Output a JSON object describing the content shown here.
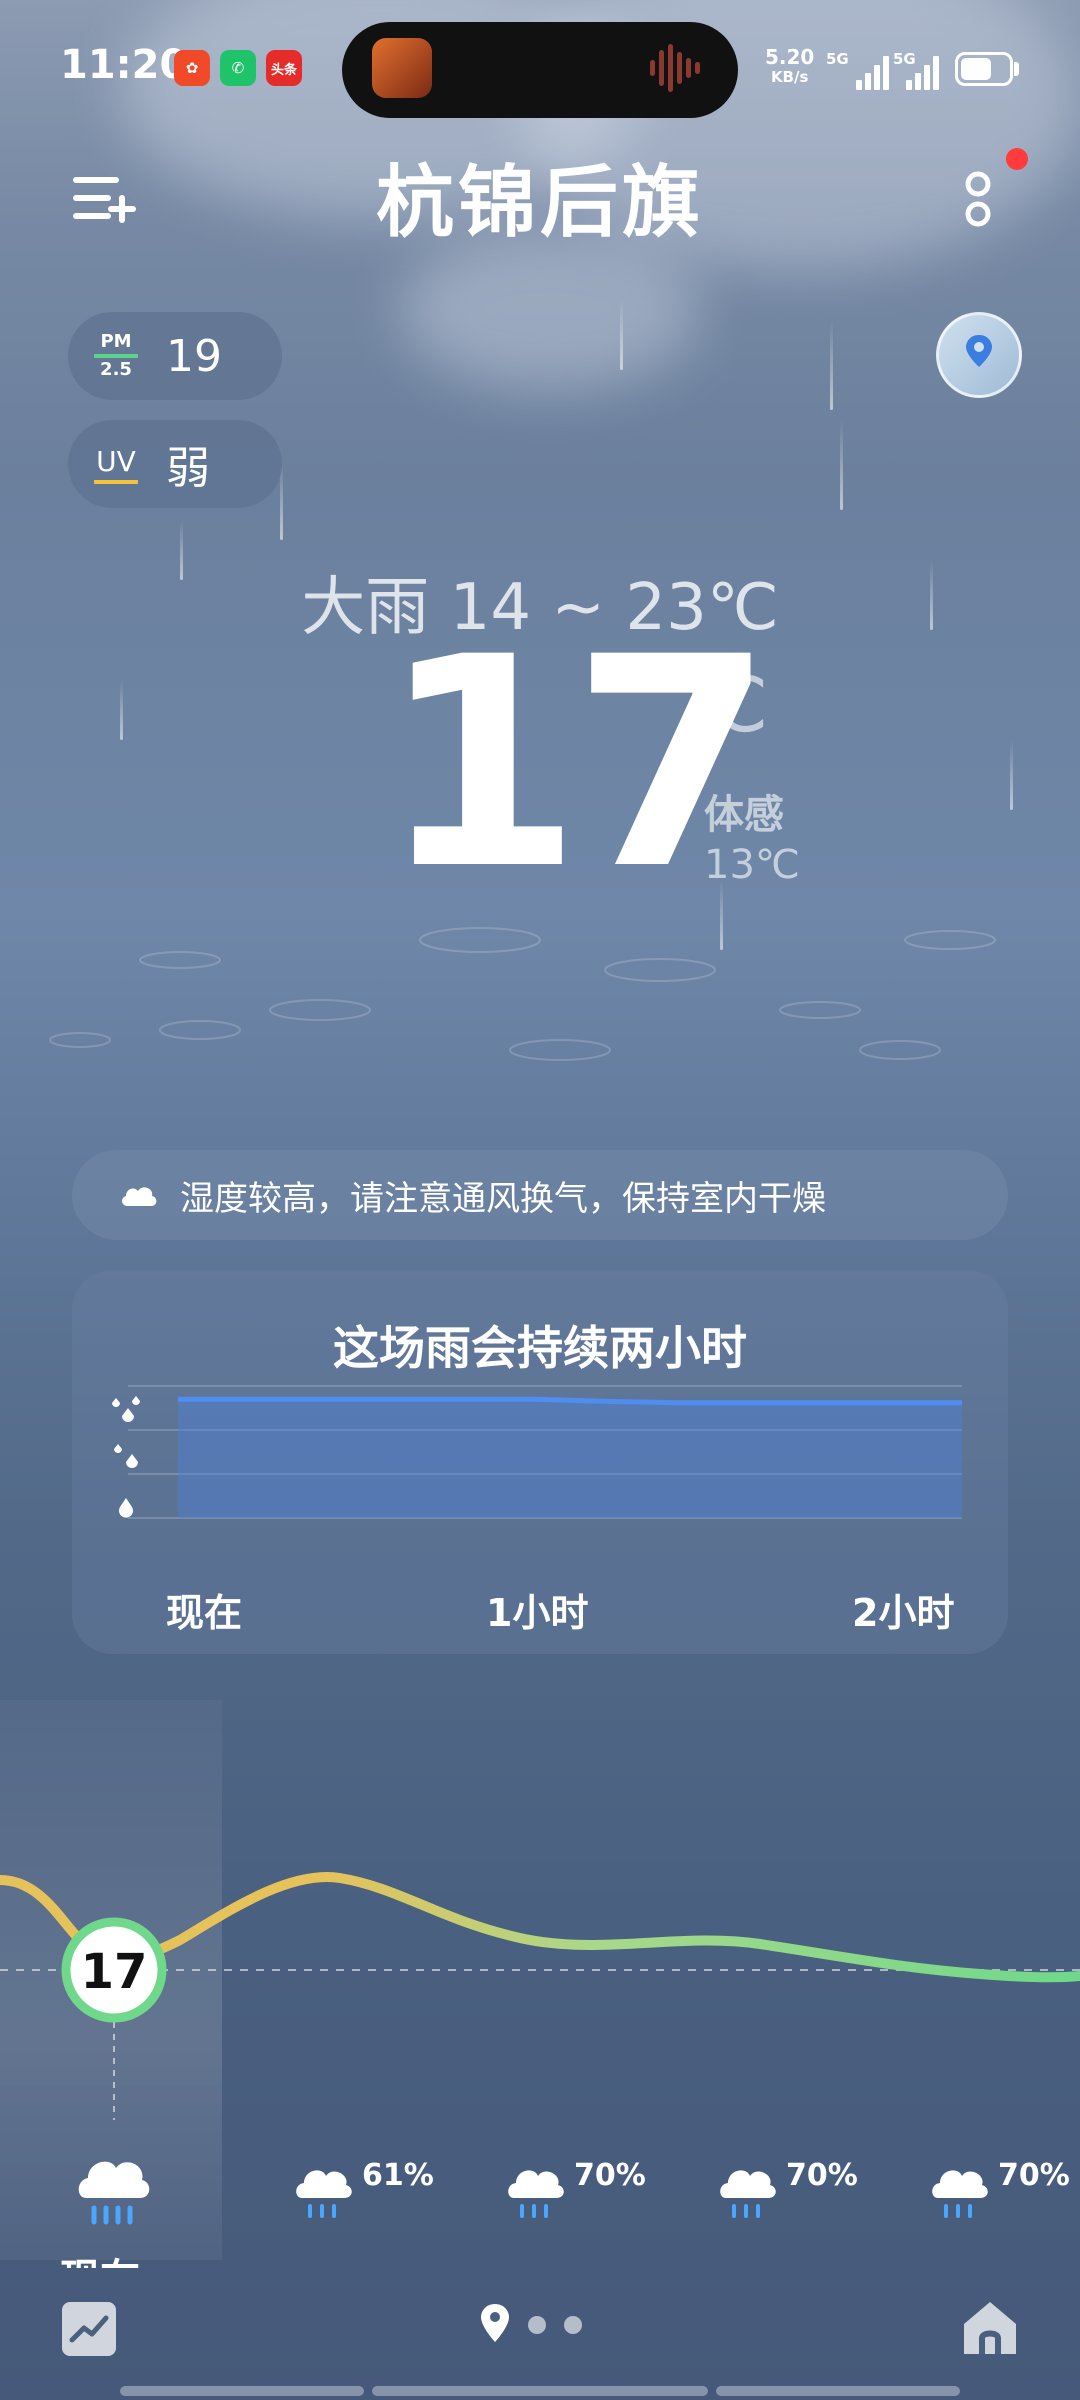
{
  "status_bar": {
    "time": "11:20",
    "app_badges": [
      "weibo-icon",
      "phone-icon",
      "头条"
    ],
    "net_speed_value": "5.20",
    "net_speed_unit": "KB/s",
    "sim1_label": "5G",
    "sim2_label": "5G"
  },
  "header": {
    "city": "杭锦后旗",
    "menu_icon": "add-city-icon",
    "more_icon": "more-options-icon",
    "notification_dot": true
  },
  "aqi": {
    "label_top": "PM",
    "label_bottom": "2.5",
    "value": "19"
  },
  "uv": {
    "label": "UV",
    "value": "弱"
  },
  "current": {
    "condition_range": "大雨 14 ~ 23℃",
    "temperature": "17",
    "unit": "℃",
    "feels_label": "体感",
    "feels_value": "13℃"
  },
  "tip": {
    "icon": "cloud-icon",
    "text": "湿度较高，请注意通风换气，保持室内干燥"
  },
  "rain_card": {
    "title": "这场雨会持续两小时",
    "time_labels": [
      "现在",
      "1小时",
      "2小时"
    ],
    "y_icons": [
      "heavy-rain-drops-icon",
      "moderate-rain-drops-icon",
      "light-rain-drop-icon"
    ]
  },
  "chart_data": {
    "type": "area",
    "title": "这场雨会持续两小时",
    "x_labels": [
      "现在",
      "1小时",
      "2小时"
    ],
    "y_levels": [
      "light",
      "moderate",
      "heavy"
    ],
    "series": [
      {
        "values": [
          2.7,
          2.7,
          2.7,
          2.7,
          2.7,
          2.7,
          2.65,
          2.62,
          2.62,
          2.62,
          2.62,
          2.62
        ]
      }
    ]
  },
  "hourly": {
    "current_temp": "17",
    "items": [
      {
        "icon": "heavy-rain-icon",
        "pct": "",
        "label": "现在"
      },
      {
        "icon": "rain-icon",
        "pct": "61%",
        "label": ""
      },
      {
        "icon": "rain-icon",
        "pct": "70%",
        "label": ""
      },
      {
        "icon": "rain-icon",
        "pct": "70%",
        "label": ""
      },
      {
        "icon": "rain-icon",
        "pct": "70%",
        "label": ""
      }
    ]
  },
  "bottom_nav": {
    "left_icon": "trend-chart-icon",
    "pages": [
      "location-icon",
      "page-dot",
      "page-dot"
    ],
    "right_icon": "home-icon"
  },
  "colors": {
    "accent_line": "#4f8ef0",
    "temp_curve_warm": "#e6c25a",
    "temp_curve_cool": "#6fd88a",
    "uv_underline": "#f3c33b",
    "pm_bar": "#5bd38a",
    "notification": "#ff3b3b"
  }
}
